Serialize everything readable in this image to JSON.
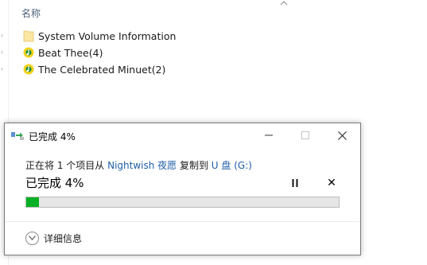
{
  "explorer": {
    "column_header": "名称",
    "files": [
      {
        "name": "System Volume Information",
        "icon": "folder-icon"
      },
      {
        "name": "Beat Thee(4)",
        "icon": "audio-file-icon"
      },
      {
        "name": "The Celebrated Minuet(2)",
        "icon": "audio-file-icon"
      }
    ]
  },
  "dialog": {
    "title": "已完成 4%",
    "desc_prefix": "正在将 1 个项目从 ",
    "source": "Nightwish 夜愿",
    "desc_middle": " 复制到 ",
    "destination": "U 盘 (G:)",
    "progress_label": "已完成 4%",
    "progress_percent": 4,
    "details_label": "详细信息",
    "cancel_glyph": "✕"
  },
  "colors": {
    "progress_fill": "#06b025",
    "link": "#1f5fa8"
  }
}
